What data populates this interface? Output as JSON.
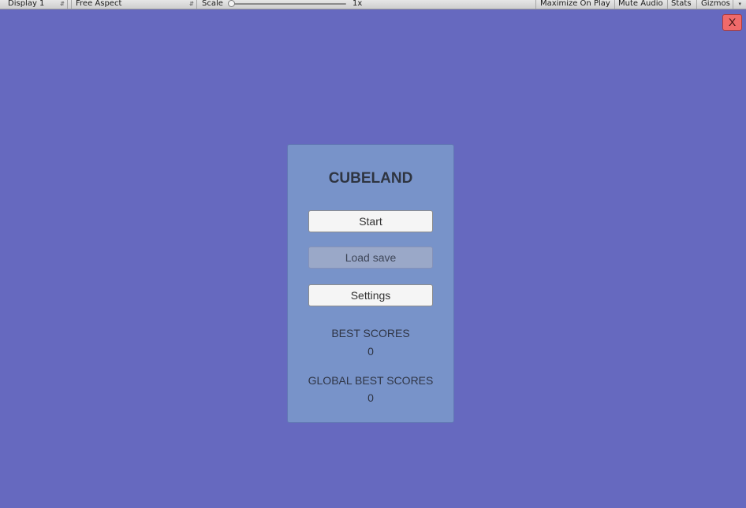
{
  "toolbar": {
    "display": "Display 1",
    "aspect": "Free Aspect",
    "scale_label": "Scale",
    "scale_value": "1x",
    "scale_level": 0,
    "maximize": "Maximize On Play",
    "mute": "Mute Audio",
    "stats": "Stats",
    "gizmos": "Gizmos"
  },
  "close": {
    "label": "X"
  },
  "menu": {
    "title": "CUBELAND",
    "start": "Start",
    "load_save": "Load save",
    "settings": "Settings",
    "best_scores_label": "BEST SCORES",
    "best_scores_value": "0",
    "global_best_label": "GLOBAL BEST SCORES",
    "global_best_value": "0"
  },
  "colors": {
    "background": "#6669bf",
    "panel": "#7893c9",
    "close_button": "#f06a6a"
  }
}
